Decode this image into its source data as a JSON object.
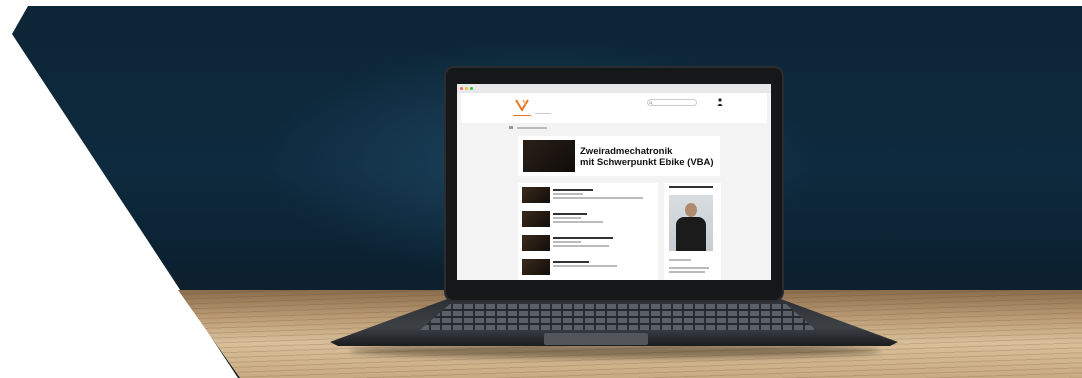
{
  "scene": {
    "background_color": "#0e2a3e",
    "accent_color": "#e87722"
  },
  "browser": {
    "window_dots": [
      "#ff5f57",
      "#febc2e",
      "#28c840"
    ]
  },
  "site": {
    "logo_icon": "orange-v-logo-icon",
    "search_icon": "search-icon",
    "user_icon": "user-icon"
  },
  "course": {
    "title_line1": "Zweiradmechatronik",
    "title_line2": "mit Schwerpunkt Ebike (VBA)"
  }
}
